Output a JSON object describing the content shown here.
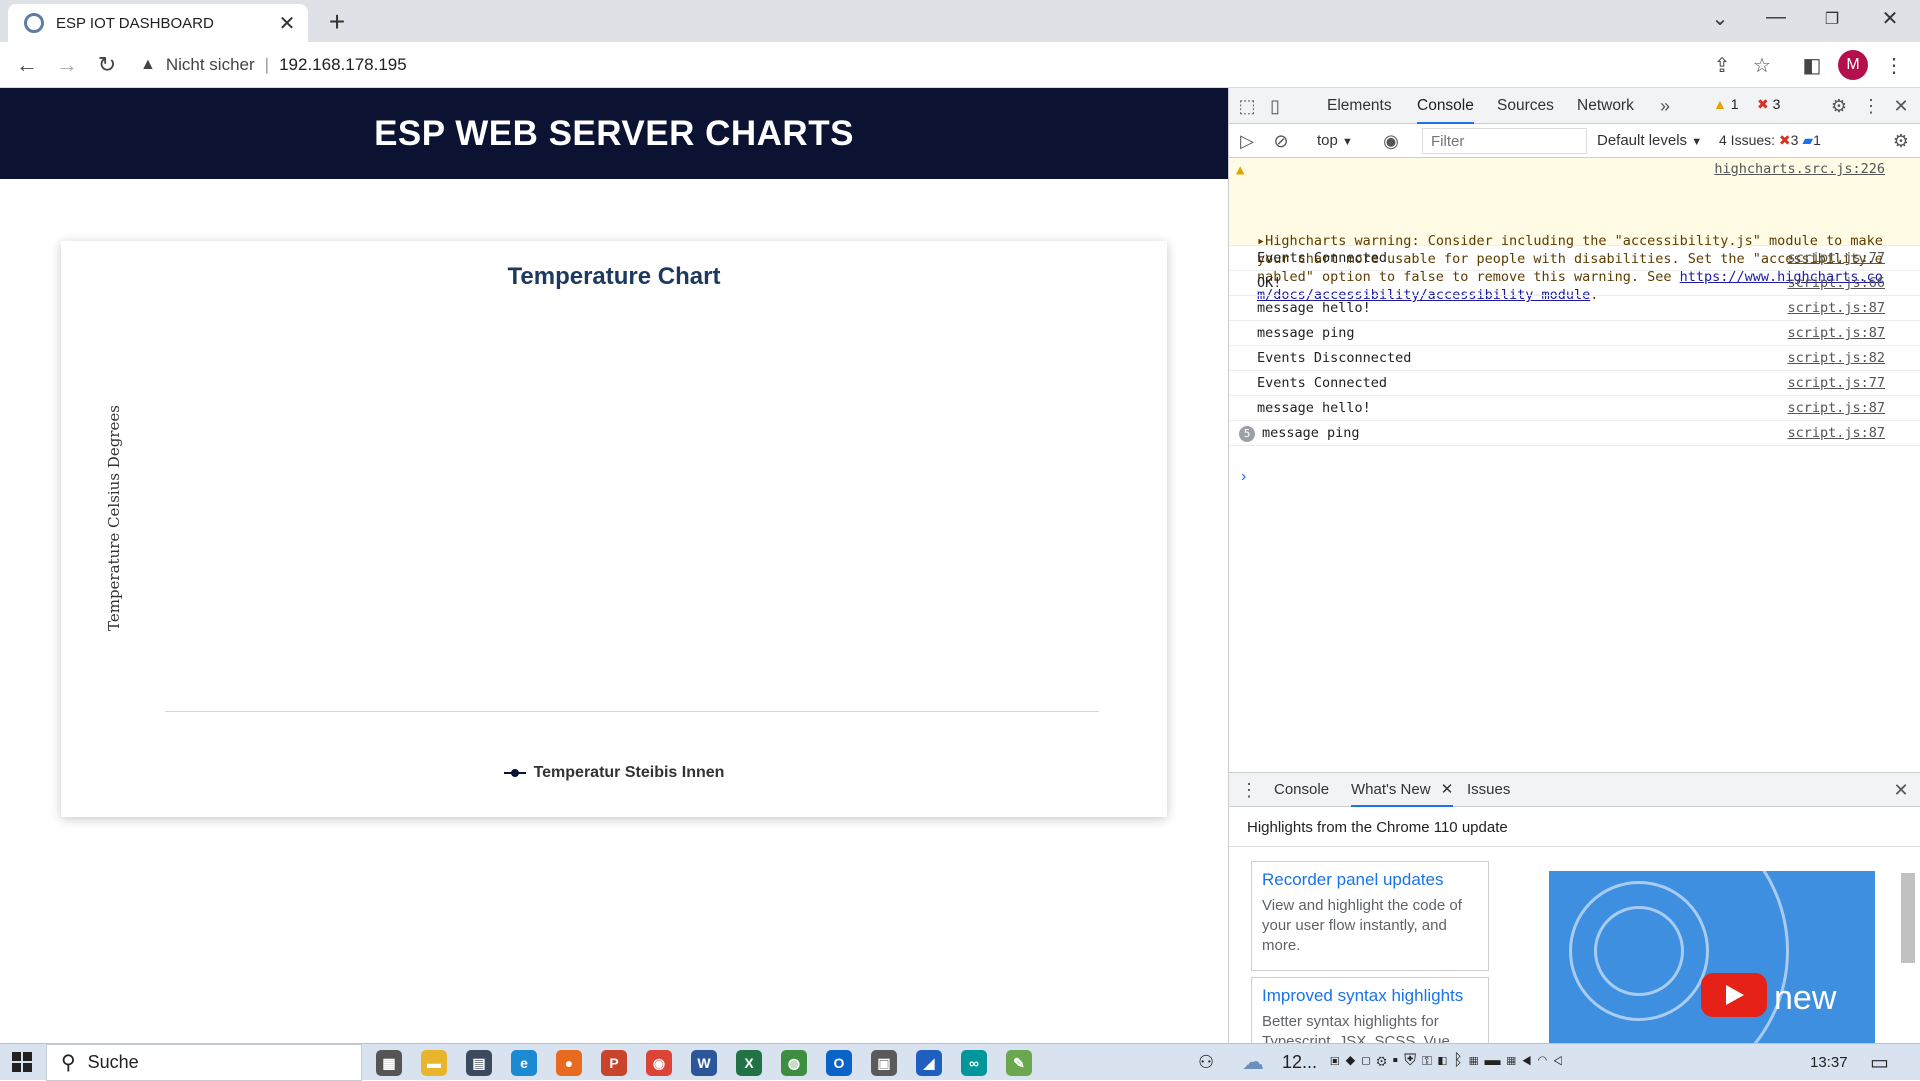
{
  "browser": {
    "tab_title": "ESP IOT DASHBOARD",
    "omnibox_security": "Nicht sicher",
    "url": "192.168.178.195",
    "avatar_letter": "M"
  },
  "page": {
    "banner_title": "ESP WEB SERVER CHARTS",
    "chart_data": {
      "type": "line",
      "title": "Temperature Chart",
      "ylabel": "Temperature Celsius Degrees",
      "xlabel": "",
      "series": [
        {
          "name": "Temperatur Steibis Innen",
          "color": "#0c1232",
          "values": []
        }
      ]
    }
  },
  "devtools": {
    "tabs": [
      "Elements",
      "Console",
      "Sources",
      "Network"
    ],
    "active_tab": "Console",
    "warning_count": "1",
    "error_count": "3",
    "context": "top",
    "filter_placeholder": "Filter",
    "levels": "Default levels",
    "issues_label": "4 Issues:",
    "issues_errors": "3",
    "issues_info": "1",
    "warning": {
      "text": "Highcharts warning: Consider including the \"accessibility.js\" module to make your chart more usable for people with disabilities. Set the \"accessibility.enabled\" option to false to remove this warning. See ",
      "link": "https://www.highcharts.com/docs/accessibility/accessibility-module",
      "link_tail": ".",
      "source": "highcharts.src.js:226"
    },
    "messages": [
      {
        "text": "Events Connected",
        "source": "script.js:77"
      },
      {
        "text": "OK!",
        "source": "script.js:66"
      },
      {
        "text": "message hello!",
        "source": "script.js:87"
      },
      {
        "text": "message ping",
        "source": "script.js:87"
      },
      {
        "text": "Events Disconnected",
        "source": "script.js:82"
      },
      {
        "text": "Events Connected",
        "source": "script.js:77"
      },
      {
        "text": "message hello!",
        "source": "script.js:87"
      },
      {
        "text": "message ping",
        "source": "script.js:87",
        "repeat": "5"
      }
    ],
    "drawer": {
      "tabs": [
        "Console",
        "What's New",
        "Issues"
      ],
      "active": "What's New",
      "headline": "Highlights from the Chrome 110 update",
      "cards": [
        {
          "title": "Recorder panel updates",
          "body": "View and highlight the code of your user flow instantly, and more."
        },
        {
          "title": "Improved syntax highlights",
          "body": "Better syntax highlights for Typescript, JSX, SCSS, Vue and more."
        }
      ],
      "image_text": "new"
    }
  },
  "taskbar": {
    "search_label": "Suche",
    "weather": "12...",
    "clock": "13:37",
    "apps": [
      {
        "name": "task-view",
        "glyph": "▦",
        "color": "#555"
      },
      {
        "name": "file-explorer",
        "glyph": "▬",
        "color": "#e8b52c"
      },
      {
        "name": "calculator",
        "glyph": "▤",
        "color": "#3b4a5c"
      },
      {
        "name": "edge",
        "glyph": "e",
        "color": "#1b8ad2"
      },
      {
        "name": "firefox",
        "glyph": "●",
        "color": "#e86a1f"
      },
      {
        "name": "powerpoint",
        "glyph": "P",
        "color": "#c8442b"
      },
      {
        "name": "chrome",
        "glyph": "◉",
        "color": "#db4437"
      },
      {
        "name": "word",
        "glyph": "W",
        "color": "#2b579a"
      },
      {
        "name": "excel",
        "glyph": "X",
        "color": "#217346"
      },
      {
        "name": "app-green",
        "glyph": "◍",
        "color": "#3e8e41"
      },
      {
        "name": "outlook",
        "glyph": "O",
        "color": "#0a64c8"
      },
      {
        "name": "monitor",
        "glyph": "▣",
        "color": "#5a5a5a"
      },
      {
        "name": "drawing-app",
        "glyph": "◢",
        "color": "#1f5fbf"
      },
      {
        "name": "arduino",
        "glyph": "∞",
        "color": "#00979c"
      },
      {
        "name": "notepad",
        "glyph": "✎",
        "color": "#6aa84f"
      }
    ]
  }
}
